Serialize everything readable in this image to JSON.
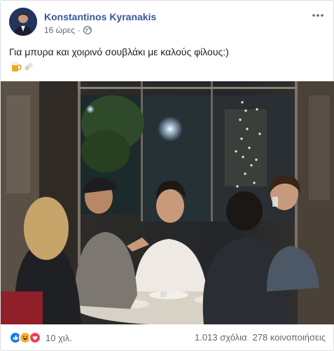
{
  "post": {
    "author": "Konstantinos Kyranakis",
    "time": "16 ώρες",
    "separator": "·",
    "text": "Για μπυρα και χοιρινό σουβλάκι με καλούς φίλους:)",
    "emojis": [
      "beer-mug-icon",
      "pill-icon"
    ]
  },
  "footer": {
    "reactions": [
      "like-icon",
      "haha-icon",
      "love-icon"
    ],
    "reaction_count": "10 χιλ.",
    "comments": "1.013 σχόλια",
    "shares": "278 κοινοποιήσεις"
  },
  "colors": {
    "link": "#385898",
    "meta": "#606770",
    "like": "#1877f2",
    "love": "#f33e58",
    "haha": "#f7b125"
  }
}
